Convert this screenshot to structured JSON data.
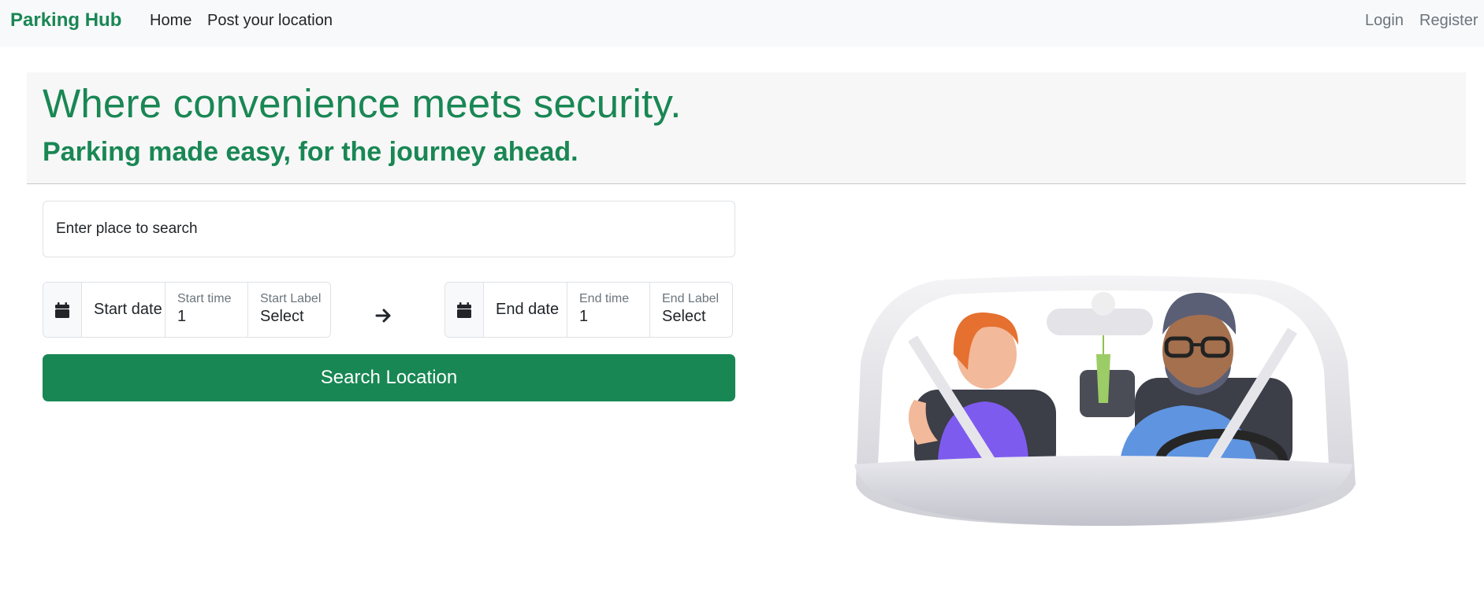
{
  "navbar": {
    "brand": "Parking Hub",
    "links": [
      "Home",
      "Post your location"
    ],
    "auth": {
      "login": "Login",
      "register": "Register"
    }
  },
  "hero": {
    "title": "Where convenience meets security.",
    "subtitle": "Parking made easy, for the journey ahead."
  },
  "search": {
    "placeholder": "Enter place to search",
    "start": {
      "date_label": "Start date",
      "time_label": "Start time",
      "time_value": "1",
      "label_label": "Start Label",
      "label_value": "Select"
    },
    "end": {
      "date_label": "End date",
      "time_label": "End time",
      "time_value": "1",
      "label_label": "End Label",
      "label_value": "Select"
    },
    "button": "Search Location"
  },
  "icons": {
    "calendar": "calendar-icon",
    "arrow": "arrow-right-icon",
    "illustration": "car-passengers-illustration"
  },
  "colors": {
    "brand": "#198754",
    "navbar_bg": "#f8f9fa",
    "hero_bg": "#f7f7f7"
  }
}
